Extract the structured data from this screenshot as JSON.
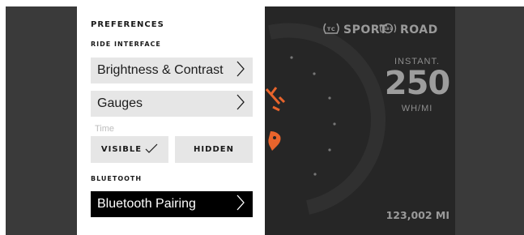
{
  "panel": {
    "title": "PREFERENCES",
    "ride_interface_heading": "RIDE INTERFACE",
    "brightness_label": "Brightness & Contrast",
    "gauges_label": "Gauges",
    "time_label": "Time",
    "time_options": [
      "VISIBLE",
      "HIDDEN"
    ],
    "time_selected": "VISIBLE",
    "bluetooth_heading": "BLUETOOTH",
    "bluetooth_pairing_label": "Bluetooth Pairing"
  },
  "dashboard": {
    "traction_control": "SPORT",
    "traction_icon": "tc-icon",
    "abs_mode": "ROAD",
    "abs_icon": "abs-icon",
    "instant_label": "INSTANT.",
    "instant_value": "250",
    "instant_unit": "WH/MI",
    "odometer": "123,002 MI"
  },
  "colors": {
    "panel_bg": "#ffffff",
    "button_bg": "#e6e6e6",
    "selected_button_bg": "#000000",
    "dash_bg": "#262626",
    "accent": "#e8642c"
  }
}
